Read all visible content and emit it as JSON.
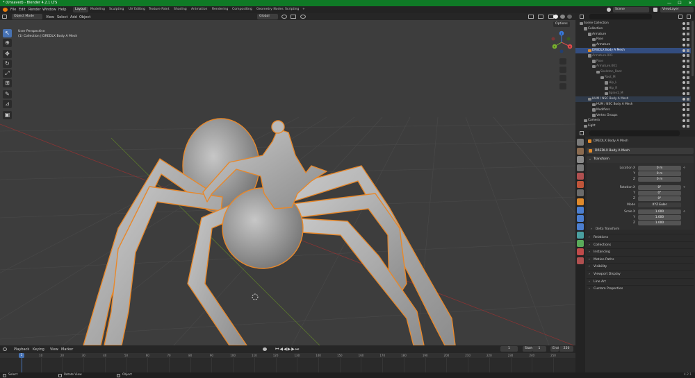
{
  "window": {
    "title": "* (Unsaved) - Blender 4.2.1 LTS",
    "min_glyph": "—",
    "max_glyph": "☐",
    "close_glyph": "✕"
  },
  "menubar": {
    "menus": [
      "File",
      "Edit",
      "Render",
      "Window",
      "Help"
    ],
    "workspaces": [
      "Layout",
      "Modeling",
      "Sculpting",
      "UV Editing",
      "Texture Paint",
      "Shading",
      "Animation",
      "Rendering",
      "Compositing",
      "Geometry Nodes",
      "Scripting"
    ],
    "active_workspace": "Layout",
    "add_tab": "+",
    "scene": "Scene",
    "view_layer": "ViewLayer"
  },
  "viewport_header": {
    "mode": "Object Mode",
    "menus": [
      "View",
      "Select",
      "Add",
      "Object"
    ],
    "orientation": "Global",
    "options": "Options"
  },
  "viewport": {
    "overlay_line1": "User Perspective",
    "overlay_line2": "(1) Collection | DREDLX Body A Mesh",
    "gizmo_x": "X",
    "gizmo_y": "Y",
    "gizmo_z": "Z"
  },
  "timeline": {
    "menus": [
      "Playback",
      "Keying",
      "View",
      "Marker"
    ],
    "current_frame": "1",
    "start_label": "Start",
    "start": "1",
    "end_label": "End",
    "end": "250",
    "ticks": [
      "10",
      "20",
      "30",
      "40",
      "50",
      "60",
      "70",
      "80",
      "90",
      "100",
      "110",
      "120",
      "130",
      "140",
      "150",
      "160",
      "170",
      "180",
      "190",
      "200",
      "210",
      "220",
      "230",
      "240",
      "250"
    ],
    "playhead": "1"
  },
  "statusbar": {
    "left1": "Select",
    "left2": "Rotate View",
    "left3": "Object",
    "version": "4.2.1"
  },
  "outliner": {
    "header_search": "",
    "rows": [
      {
        "label": "Scene Collection",
        "indent": 0,
        "state": "none"
      },
      {
        "label": "Collection",
        "indent": 1,
        "state": "none"
      },
      {
        "label": "Armature",
        "indent": 2,
        "state": "none"
      },
      {
        "label": "Pose",
        "indent": 3,
        "state": "none"
      },
      {
        "label": "Armature",
        "indent": 3,
        "state": "none"
      },
      {
        "label": "DREDLX Body A Mesh",
        "indent": 2,
        "state": "selected"
      },
      {
        "label": "Armature.001",
        "indent": 2,
        "state": "dim"
      },
      {
        "label": "Pose",
        "indent": 3,
        "state": "dim"
      },
      {
        "label": "Armature.001",
        "indent": 3,
        "state": "dim"
      },
      {
        "label": "Skeleton_Root",
        "indent": 4,
        "state": "dim"
      },
      {
        "label": "Root_M",
        "indent": 5,
        "state": "dim"
      },
      {
        "label": "Hip_L",
        "indent": 6,
        "state": "dim"
      },
      {
        "label": "Hip_R",
        "indent": 6,
        "state": "dim"
      },
      {
        "label": "Spine1_M",
        "indent": 6,
        "state": "dim"
      },
      {
        "label": "HUM / NSC Body A Mesh",
        "indent": 2,
        "state": "highlight"
      },
      {
        "label": "HUM / NSC Body A Mesh",
        "indent": 3,
        "state": "none"
      },
      {
        "label": "Modifiers",
        "indent": 3,
        "state": "none"
      },
      {
        "label": "Vertex Groups",
        "indent": 3,
        "state": "none"
      },
      {
        "label": "Camera",
        "indent": 1,
        "state": "none"
      },
      {
        "label": "Light",
        "indent": 1,
        "state": "none"
      }
    ]
  },
  "properties": {
    "object_name": "DREDLX Body A Mesh",
    "object_name_field": "DREDLX Body A Mesh",
    "transform": "Transform",
    "location_label": "Location X",
    "y": "Y",
    "z": "Z",
    "loc_x": "0 m",
    "loc_y": "0 m",
    "loc_z": "0 m",
    "rotation_label": "Rotation X",
    "rot_x": "0°",
    "rot_y": "0°",
    "rot_z": "0°",
    "mode_label": "Mode",
    "mode_value": "XYZ Euler",
    "scale_label": "Scale X",
    "scale_x": "1.000",
    "scale_y": "1.000",
    "scale_z": "1.000",
    "delta": "Delta Transform",
    "sections": [
      "Relations",
      "Collections",
      "Instancing",
      "Motion Paths",
      "Visibility",
      "Viewport Display",
      "Line Art",
      "Custom Properties"
    ]
  },
  "colors": {
    "accent": "#4772b3",
    "selection_outline": "#e8882a",
    "titlebar": "#0f7a26"
  }
}
